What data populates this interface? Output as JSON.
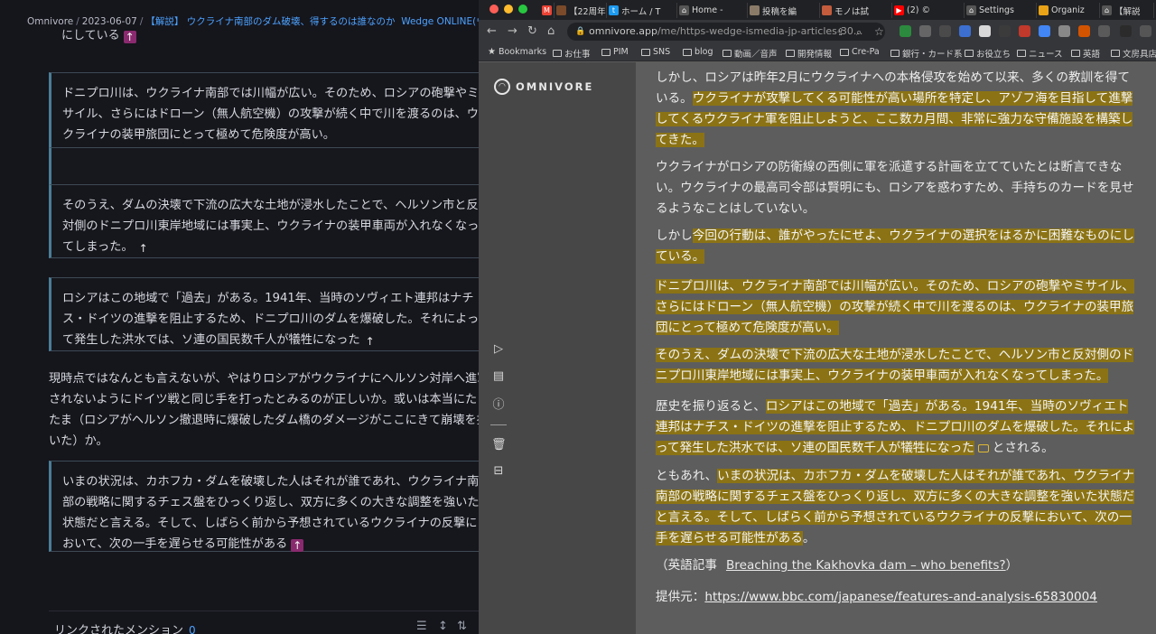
{
  "left": {
    "breadcrumb": {
      "root": "Omnivore",
      "date": "2023-06-07",
      "title": "【解説】 ウクライナ南部のダム破壊、得するのは誰なのか",
      "source": "Wedge ONLINE(ウェッジ・オン"
    },
    "top_fragment": "にしている",
    "blocks": [
      "ドニプロ川は、ウクライナ南部では川幅が広い。そのため、ロシアの砲撃やミサイル、さらにはドローン（無人航空機）の攻撃が続く中で川を渡るのは、ウクライナの装甲旅団にとって極めて危険度が高い。",
      "",
      "そのうえ、ダムの決壊で下流の広大な土地が浸水したことで、ヘルソン市と反対側のドニプロ川東岸地域には事実上、ウクライナの装甲車両が入れなくなってしまった。",
      "ロシアはこの地域で「過去」がある。1941年、当時のソヴィエト連邦はナチス・ドイツの進撃を阻止するため、ドニプロ川のダムを爆破した。それによって発生した洪水では、ソ連の国民数千人が犠牲になった",
      "いまの状況は、カホフカ・ダムを破壊した人はそれが誰であれ、ウクライナ南部の戦略に関するチェス盤をひっくり返し、双方に多くの大きな調整を強いた状態だと言える。そして、しばらく前から予想されているウクライナの反撃において、次の一手を遅らせる可能性がある"
    ],
    "note": "現時点ではなんとも言えないが、やはりロシアがウクライナにヘルソン対岸へ進軍されないようにドイツ戦と同じ手を打ったとみるのが正しいか。或いは本当にたまたま（ロシアがヘルソン撤退時に爆破したダム橋のダメージがここにきて崩壊を招いた）か。",
    "backlink_glyph": "↑",
    "footer": {
      "label": "リンクされたメンション",
      "count": "0"
    }
  },
  "browser": {
    "tabs": [
      {
        "label": "",
        "icon": "gmail-icon",
        "color": "#ea4335",
        "glyph": "M"
      },
      {
        "label": "【22周年",
        "icon": "favicon",
        "color": "#7a4a2a",
        "glyph": ""
      },
      {
        "label": "ホーム / T",
        "icon": "twitter-icon",
        "color": "#1d9bf0",
        "glyph": "t"
      },
      {
        "label": "Home -",
        "icon": "omnivore-icon",
        "color": "#555555",
        "glyph": "⌂"
      },
      {
        "label": "投稿を編",
        "icon": "avatar-icon",
        "color": "#8a7b68",
        "glyph": ""
      },
      {
        "label": "モノは試",
        "icon": "avatar-icon",
        "color": "#c25c3c",
        "glyph": ""
      },
      {
        "label": "(2) ©",
        "icon": "youtube-icon",
        "color": "#ff0000",
        "glyph": "▶"
      },
      {
        "label": "Settings",
        "icon": "omnivore-icon",
        "color": "#555555",
        "glyph": "⌂"
      },
      {
        "label": "Organiz",
        "icon": "chrome-icon",
        "color": "#e8a317",
        "glyph": ""
      },
      {
        "label": "【解説",
        "icon": "omnivore-icon",
        "color": "#555555",
        "glyph": "⌂"
      }
    ],
    "url": {
      "host": "omnivore.app",
      "path": "/me/https-wedge-ismedia-jp-articles-30..."
    },
    "bookmarks": [
      "Bookmarks",
      "お仕事",
      "PIM",
      "SNS",
      "blog",
      "動画／音声",
      "開発情報",
      "Cre-Pa",
      "銀行・カード系",
      "お役立ち",
      "ニュース",
      "英語",
      "文房具店"
    ],
    "brand": "OMNIVORE",
    "article": {
      "p1": {
        "plain": "しかし、ロシアは昨年2月にウクライナへの本格侵攻を始めて以来、多くの教訓を得ている。",
        "hl": "ウクライナが攻撃してくる可能性が高い場所を特定し、アゾフ海を目指して進撃してくるウクライナ軍を阻止しようと、ここ数カ月間、非常に強力な守備施設を構築してきた。"
      },
      "p2": "ウクライナがロシアの防衛線の西側に軍を派遣する計画を立てていたとは断言できない。ウクライナの最高司令部は賢明にも、ロシアを惑わすため、手持ちのカードを見せるようなことはしていない。",
      "p3": {
        "plain": "しかし",
        "hl": "今回の行動は、誰がやったにせよ、ウクライナの選択をはるかに困難なものにしている。"
      },
      "p4": "ドニプロ川は、ウクライナ南部では川幅が広い。そのため、ロシアの砲撃やミサイル、さらにはドローン（無人航空機）の攻撃が続く中で川を渡るのは、ウクライナの装甲旅団にとって極めて危険度が高い。",
      "p5": "そのうえ、ダムの決壊で下流の広大な土地が浸水したことで、ヘルソン市と反対側のドニプロ川東岸地域には事実上、ウクライナの装甲車両が入れなくなってしまった。",
      "p6": {
        "plain_a": "歴史を振り返ると、",
        "hl": "ロシアはこの地域で「過去」がある。1941年、当時のソヴィエト連邦はナチス・ドイツの進撃を阻止するため、ドニプロ川のダムを爆破した。それによって発生した洪水では、ソ連の国民数千人が犠牲になった",
        "plain_b": "とされる。"
      },
      "p7": {
        "plain": "ともあれ、",
        "hl": "いまの状況は、カホフカ・ダムを破壊した人はそれが誰であれ、ウクライナ南部の戦略に関するチェス盤をひっくり返し、双方に多くの大きな調整を強いた状態だと言える。そして、しばらく前から予想されているウクライナの反撃において、次の一手を遅らせる可能性がある",
        "plain_b": "。"
      },
      "english": {
        "prefix": "（英語記事",
        "link": "Breaching the Kakhovka dam – who benefits?",
        "suffix": "）"
      },
      "source": {
        "prefix": "提供元：",
        "link": "https://www.bbc.com/japanese/features-and-analysis-65830004"
      }
    },
    "colors": {
      "highlight": "#8b7315",
      "backlink": "#8a2a6e",
      "accent_link": "#4da3ff"
    }
  }
}
